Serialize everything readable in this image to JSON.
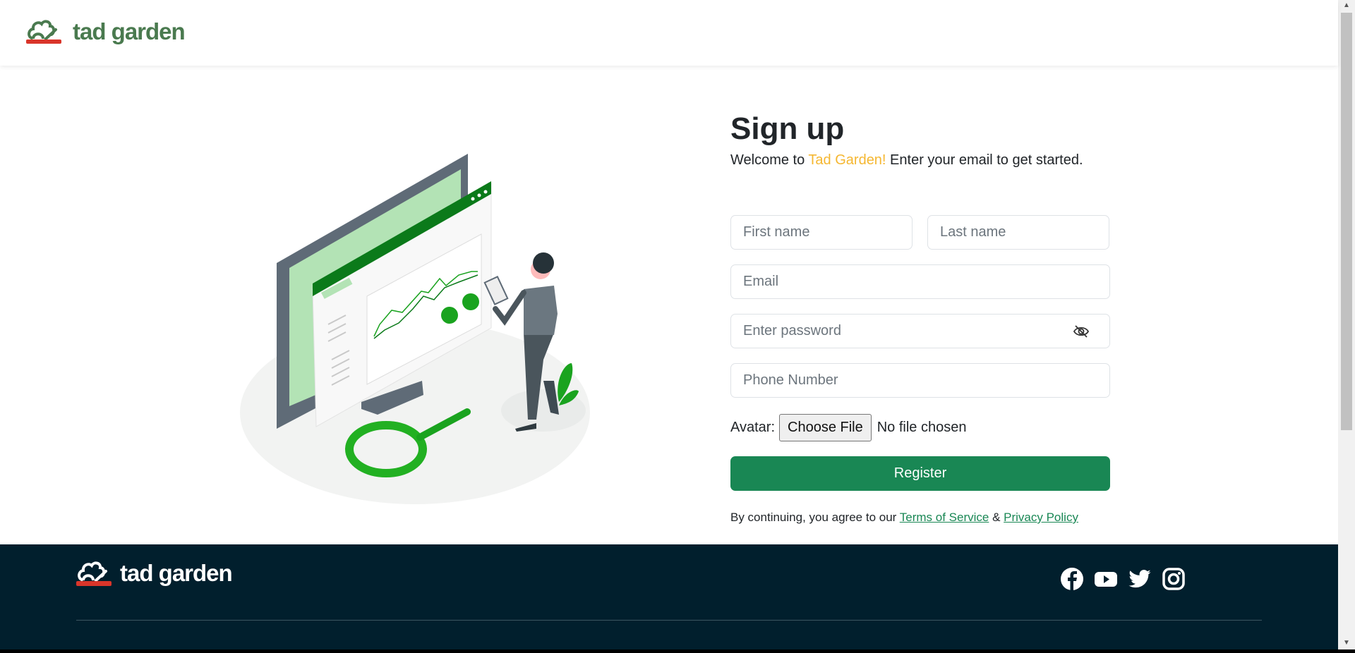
{
  "header": {
    "logo_text": "tad garden"
  },
  "signup": {
    "title": "Sign up",
    "subtitle_prefix": "Welcome to ",
    "subtitle_brand": "Tad Garden!",
    "subtitle_suffix": " Enter your email to get started.",
    "first_name_placeholder": "First name",
    "last_name_placeholder": "Last name",
    "email_placeholder": "Email",
    "password_placeholder": "Enter password",
    "phone_placeholder": "Phone Number",
    "avatar_label": "Avatar:",
    "choose_file_label": "Choose File",
    "no_file_text": "No file chosen",
    "register_label": "Register",
    "terms_prefix": "By continuing, you agree to our ",
    "terms_link": "Terms of Service",
    "terms_amp": " & ",
    "privacy_link": "Privacy Policy"
  },
  "footer": {
    "logo_text": "tad garden",
    "social": [
      "facebook-icon",
      "youtube-icon",
      "twitter-icon",
      "instagram-icon"
    ]
  },
  "colors": {
    "brand_green": "#4a7a4f",
    "accent": "#f5b731",
    "button": "#198754",
    "footer_bg": "#011f2d",
    "pot_red": "#d9352a"
  }
}
